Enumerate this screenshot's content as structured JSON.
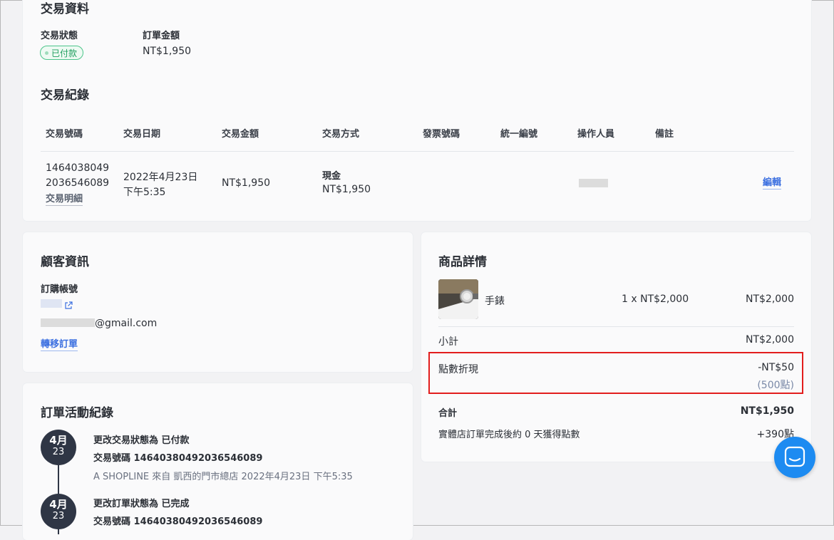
{
  "transaction": {
    "section_title": "交易資料",
    "status_label": "交易狀態",
    "status_value": "已付款",
    "amount_label": "訂單金額",
    "amount_value": "NT$1,950"
  },
  "records": {
    "title": "交易紀錄",
    "columns": [
      "交易號碼",
      "交易日期",
      "交易金額",
      "交易方式",
      "發票號碼",
      "統一編號",
      "操作人員",
      "備註"
    ],
    "row": {
      "number_line1": "1464038049",
      "number_line2": "2036546089",
      "detail_link": "交易明細",
      "date_line1": "2022年4月23日",
      "date_line2": "下午5:35",
      "amount": "NT$1,950",
      "method": "現金",
      "method_amount": "NT$1,950",
      "edit_link": "編輯"
    }
  },
  "customer": {
    "title": "顧客資訊",
    "account_label": "訂購帳號",
    "email_suffix": "@gmail.com",
    "transfer_link": "轉移訂單"
  },
  "activity": {
    "title": "訂單活動紀錄",
    "items": [
      {
        "month": "4月",
        "day": "23",
        "line1": "更改交易狀態為 已付款",
        "line2": "交易號碼 14640380492036546089",
        "line3": "A SHOPLINE 來自 凱西的門市總店 2022年4月23日 下午5:35"
      },
      {
        "month": "4月",
        "day": "23",
        "line1": "更改訂單狀態為 已完成",
        "line2": "交易號碼 14640380492036546089"
      }
    ]
  },
  "products": {
    "title": "商品詳情",
    "item_name": "手錶",
    "item_qty_price": "1 x NT$2,000",
    "item_total": "NT$2,000",
    "subtotal_label": "小計",
    "subtotal_value": "NT$2,000",
    "points_label": "點數折現",
    "points_value": "-NT$50",
    "points_count": "(500點)",
    "total_label": "合計",
    "total_value": "NT$1,950",
    "earn_label": "實體店訂單完成後約 0 天獲得點數",
    "earn_value": "+390點"
  },
  "colors": {
    "accent": "#3b6fe0",
    "paid": "#1e9e5e",
    "highlight": "#e21d1d",
    "chat": "#1d8bf1"
  }
}
